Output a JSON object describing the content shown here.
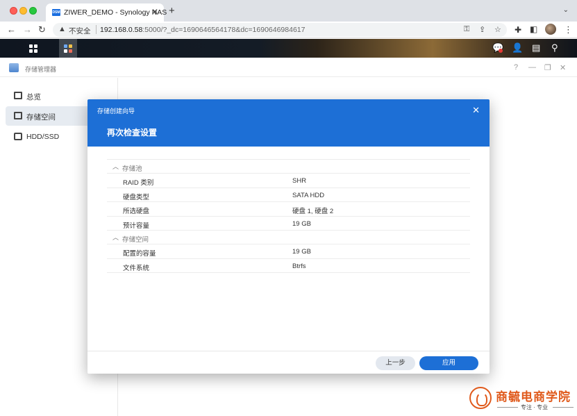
{
  "browser": {
    "tab_title": "ZIWER_DEMO - Synology NAS",
    "tab_favicon_text": "DSM",
    "tab_close": "✕",
    "new_tab": "+",
    "tab_menu": "⌄",
    "insecure_label": "不安全",
    "url_host": "192.168.0.58",
    "url_rest": ":5000/?_dc=1690646564178&dc=1690646984617"
  },
  "app": {
    "title": "存储管理器",
    "help": "?",
    "minimize": "—",
    "restore": "❐",
    "close": "✕"
  },
  "sidebar": {
    "items": [
      {
        "label": "总览"
      },
      {
        "label": "存储空间"
      },
      {
        "label": "HDD/SSD"
      }
    ]
  },
  "wizard": {
    "title": "存储创建向导",
    "close": "✕",
    "step_title": "再次检查设置",
    "groups": [
      {
        "label": "存储池",
        "rows": [
          {
            "key": "RAID 类别",
            "value": "SHR"
          },
          {
            "key": "硬盘类型",
            "value": "SATA HDD"
          },
          {
            "key": "所选硬盘",
            "value": "硬盘 1, 硬盘 2"
          },
          {
            "key": "预计容量",
            "value": "19 GB"
          }
        ]
      },
      {
        "label": "存储空间",
        "rows": [
          {
            "key": "配置的容量",
            "value": "19 GB"
          },
          {
            "key": "文件系统",
            "value": "Btrfs"
          }
        ]
      }
    ],
    "back_label": "上一步",
    "apply_label": "应用"
  },
  "watermark": {
    "brand": "商毓电商学院",
    "slogan": "专注 · 专业"
  }
}
